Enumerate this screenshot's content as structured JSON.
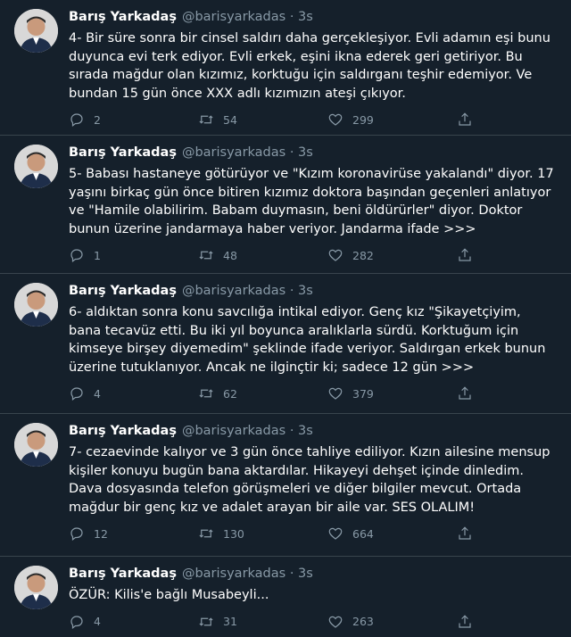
{
  "tweets": [
    {
      "name": "Barış Yarkadaş",
      "handle": "@barisyarkadas",
      "dot": "·",
      "time": "3s",
      "text": "4- Bir süre sonra bir cinsel saldırı daha gerçekleşiyor. Evli adamın eşi bunu duyunca evi terk ediyor. Evli erkek, eşini ikna ederek geri getiriyor. Bu sırada mağdur olan kızımız, korktuğu için saldırganı teşhir edemiyor. Ve bundan 15 gün önce XXX adlı kızımızın ateşi çıkıyor.",
      "replies": "2",
      "retweets": "54",
      "likes": "299"
    },
    {
      "name": "Barış Yarkadaş",
      "handle": "@barisyarkadas",
      "dot": "·",
      "time": "3s",
      "text": "5- Babası hastaneye götürüyor ve  \"Kızım koronavirüse yakalandı\" diyor. 17 yaşını birkaç gün önce bitiren kızımız doktora başından geçenleri anlatıyor ve \"Hamile olabilirim. Babam duymasın, beni öldürürler\" diyor. Doktor bunun üzerine jandarmaya haber veriyor. Jandarma ifade >>>",
      "replies": "1",
      "retweets": "48",
      "likes": "282"
    },
    {
      "name": "Barış Yarkadaş",
      "handle": "@barisyarkadas",
      "dot": "·",
      "time": "3s",
      "text": "6- aldıktan sonra konu savcılığa intikal ediyor. Genç kız \"Şikayetçiyim, bana tecavüz etti. Bu iki yıl boyunca aralıklarla sürdü. Korktuğum için kimseye birşey diyemedim\" şeklinde ifade veriyor. Saldırgan erkek bunun üzerine tutuklanıyor. Ancak ne ilginçtir ki; sadece 12 gün >>>",
      "replies": "4",
      "retweets": "62",
      "likes": "379"
    },
    {
      "name": "Barış Yarkadaş",
      "handle": "@barisyarkadas",
      "dot": "·",
      "time": "3s",
      "text": "7- cezaevinde kalıyor ve 3 gün önce tahliye ediliyor. Kızın ailesine mensup kişiler konuyu bugün bana aktardılar. Hikayeyi dehşet içinde dinledim. Dava dosyasında telefon görüşmeleri ve diğer bilgiler mevcut. Ortada mağdur bir genç kız ve adalet arayan bir aile var. SES OLALIM!",
      "replies": "12",
      "retweets": "130",
      "likes": "664"
    },
    {
      "name": "Barış Yarkadaş",
      "handle": "@barisyarkadas",
      "dot": "·",
      "time": "3s",
      "text": "ÖZÜR: Kilis'e bağlı Musabeyli...",
      "replies": "4",
      "retweets": "31",
      "likes": "263"
    }
  ],
  "colors": {
    "background": "#15202b",
    "divider": "#38444d",
    "secondary_text": "#8899a6",
    "primary_text": "#ffffff"
  },
  "icons": [
    "avatar-photo",
    "reply-icon",
    "retweet-icon",
    "like-icon",
    "share-icon"
  ]
}
